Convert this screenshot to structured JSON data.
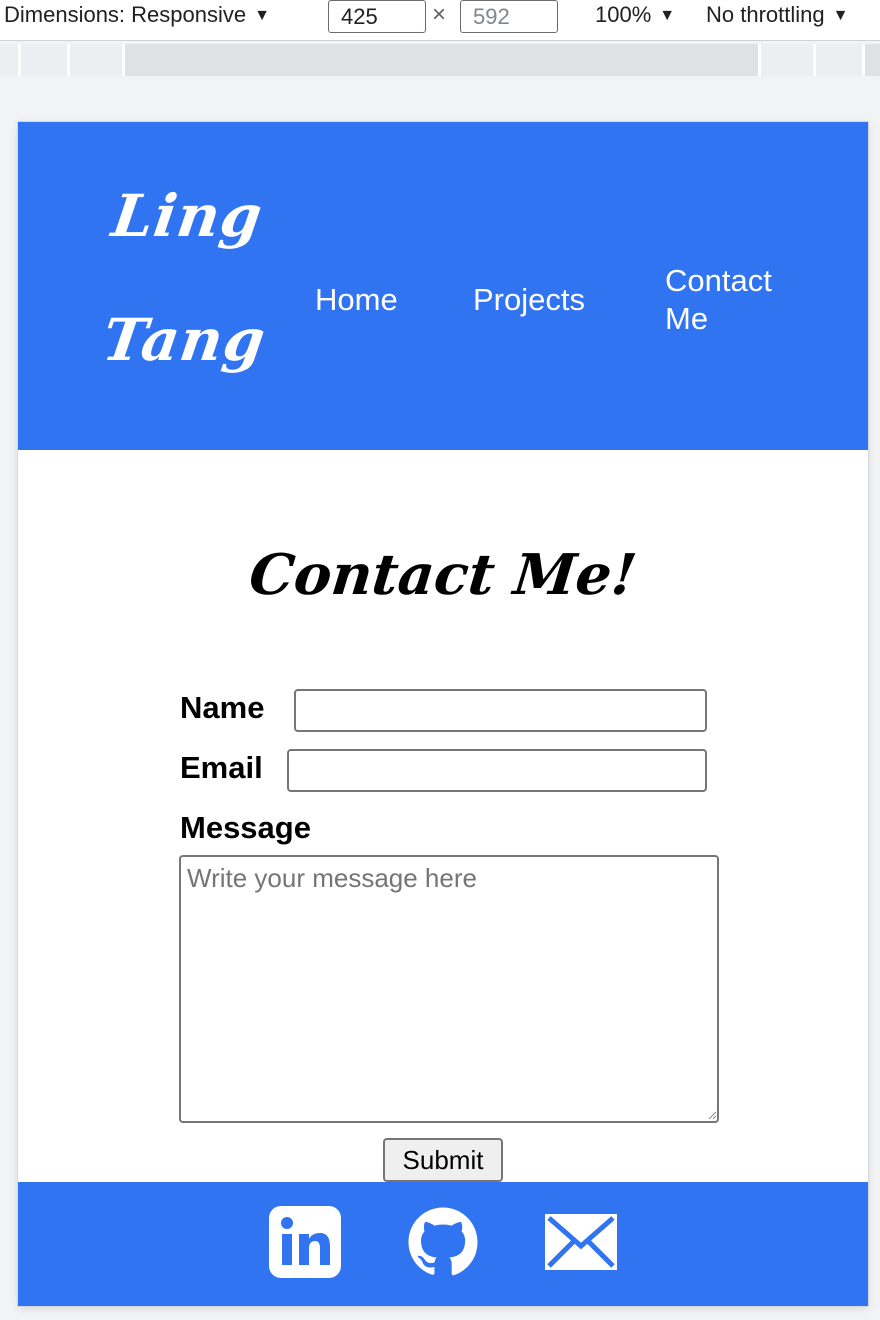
{
  "devtools": {
    "dimensions_label": "Dimensions: Responsive",
    "width_value": "425",
    "times": "×",
    "height_value": "592",
    "zoom": "100%",
    "throttling": "No throttling",
    "dropdown_arrow": "▼"
  },
  "site": {
    "logo_line1": "Ling",
    "logo_line2": "Tang",
    "nav": {
      "home": "Home",
      "projects": "Projects",
      "contact": "Contact Me"
    },
    "page_title": "Contact Me!",
    "form": {
      "name_label": "Name",
      "email_label": "Email",
      "message_label": "Message",
      "message_placeholder": "Write your message here",
      "submit_label": "Submit"
    },
    "footer": {
      "icons": [
        "linkedin-icon",
        "github-icon",
        "email-icon"
      ]
    }
  },
  "colors": {
    "brand_blue": "#3174f1",
    "text": "#000000",
    "on_brand": "#ffffff"
  }
}
